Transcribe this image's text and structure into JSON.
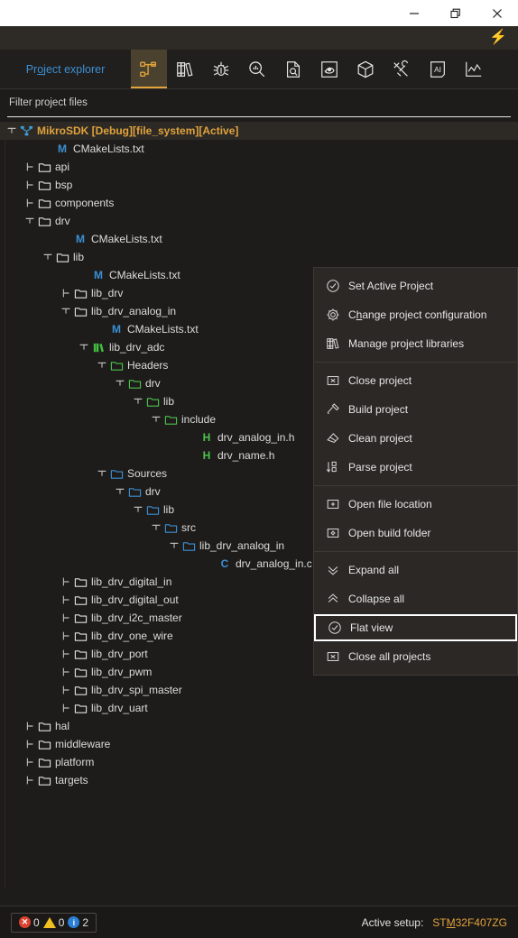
{
  "titlebar": {
    "minimize": "minimize-icon",
    "restore": "restore-icon",
    "close": "close-icon"
  },
  "boltbar": {
    "bolt": "⚡"
  },
  "toolbar": {
    "tab_label_pre": "Pr",
    "tab_label_mnemonic": "o",
    "tab_label_post": "ject explorer",
    "buttons": [
      {
        "name": "project-explorer-icon",
        "title": "Project explorer",
        "active": true
      },
      {
        "name": "library-manager-icon",
        "title": "Library Manager",
        "active": false
      },
      {
        "name": "debugger-icon",
        "title": "Debugger",
        "active": false
      },
      {
        "name": "search-icon",
        "title": "Search",
        "active": false
      },
      {
        "name": "file-preview-icon",
        "title": "File preview",
        "active": false
      },
      {
        "name": "target-icon",
        "title": "Target",
        "active": false
      },
      {
        "name": "package-icon",
        "title": "Package manager",
        "active": false
      },
      {
        "name": "tools-icon",
        "title": "Tools",
        "active": false
      },
      {
        "name": "ai-assistant-icon",
        "title": "AI assistant",
        "active": false
      },
      {
        "name": "chart-icon",
        "title": "Chart",
        "active": false
      }
    ]
  },
  "filter": {
    "placeholder": "Filter project files",
    "value": ""
  },
  "tree": {
    "rows": [
      {
        "depth": 0,
        "twisty": "expanded",
        "icon": "project-icon",
        "label": "MikroSDK [Debug][file_system][Active]",
        "color": "root",
        "root": true
      },
      {
        "depth": 2,
        "twisty": "none",
        "icon": "makefile-icon",
        "label": "CMakeLists.txt",
        "color": "white"
      },
      {
        "depth": 1,
        "twisty": "collapsed",
        "icon": "folder-white",
        "label": "api",
        "color": "white"
      },
      {
        "depth": 1,
        "twisty": "collapsed",
        "icon": "folder-white",
        "label": "bsp",
        "color": "white"
      },
      {
        "depth": 1,
        "twisty": "collapsed",
        "icon": "folder-white",
        "label": "components",
        "color": "white"
      },
      {
        "depth": 1,
        "twisty": "expanded",
        "icon": "folder-white",
        "label": "drv",
        "color": "white"
      },
      {
        "depth": 3,
        "twisty": "none",
        "icon": "makefile-icon",
        "label": "CMakeLists.txt",
        "color": "white"
      },
      {
        "depth": 2,
        "twisty": "expanded",
        "icon": "folder-white",
        "label": "lib",
        "color": "white"
      },
      {
        "depth": 4,
        "twisty": "none",
        "icon": "makefile-icon",
        "label": "CMakeLists.txt",
        "color": "white"
      },
      {
        "depth": 3,
        "twisty": "collapsed",
        "icon": "folder-white",
        "label": "lib_drv",
        "color": "white"
      },
      {
        "depth": 3,
        "twisty": "expanded",
        "icon": "folder-white",
        "label": "lib_drv_analog_in",
        "color": "white"
      },
      {
        "depth": 5,
        "twisty": "none",
        "icon": "makefile-icon",
        "label": "CMakeLists.txt",
        "color": "white"
      },
      {
        "depth": 4,
        "twisty": "expanded",
        "icon": "library-green",
        "label": "lib_drv_adc",
        "color": "white"
      },
      {
        "depth": 5,
        "twisty": "expanded",
        "icon": "folder-green",
        "label": "Headers",
        "color": "white"
      },
      {
        "depth": 6,
        "twisty": "expanded",
        "icon": "folder-green",
        "label": "drv",
        "color": "white"
      },
      {
        "depth": 7,
        "twisty": "expanded",
        "icon": "folder-green",
        "label": "lib",
        "color": "white"
      },
      {
        "depth": 8,
        "twisty": "expanded",
        "icon": "folder-green",
        "label": "include",
        "color": "white"
      },
      {
        "depth": 10,
        "twisty": "none",
        "icon": "header-icon",
        "label": "drv_analog_in.h",
        "color": "white"
      },
      {
        "depth": 10,
        "twisty": "none",
        "icon": "header-icon",
        "label": "drv_name.h",
        "color": "white"
      },
      {
        "depth": 5,
        "twisty": "expanded",
        "icon": "folder-blue",
        "label": "Sources",
        "color": "white"
      },
      {
        "depth": 6,
        "twisty": "expanded",
        "icon": "folder-blue",
        "label": "drv",
        "color": "white"
      },
      {
        "depth": 7,
        "twisty": "expanded",
        "icon": "folder-blue",
        "label": "lib",
        "color": "white"
      },
      {
        "depth": 8,
        "twisty": "expanded",
        "icon": "folder-blue",
        "label": "src",
        "color": "white"
      },
      {
        "depth": 9,
        "twisty": "expanded",
        "icon": "folder-blue",
        "label": "lib_drv_analog_in",
        "color": "white"
      },
      {
        "depth": 11,
        "twisty": "none",
        "icon": "csource-icon",
        "label": "drv_analog_in.c",
        "color": "white"
      },
      {
        "depth": 3,
        "twisty": "collapsed",
        "icon": "folder-white",
        "label": "lib_drv_digital_in",
        "color": "white"
      },
      {
        "depth": 3,
        "twisty": "collapsed",
        "icon": "folder-white",
        "label": "lib_drv_digital_out",
        "color": "white"
      },
      {
        "depth": 3,
        "twisty": "collapsed",
        "icon": "folder-white",
        "label": "lib_drv_i2c_master",
        "color": "white"
      },
      {
        "depth": 3,
        "twisty": "collapsed",
        "icon": "folder-white",
        "label": "lib_drv_one_wire",
        "color": "white"
      },
      {
        "depth": 3,
        "twisty": "collapsed",
        "icon": "folder-white",
        "label": "lib_drv_port",
        "color": "white"
      },
      {
        "depth": 3,
        "twisty": "collapsed",
        "icon": "folder-white",
        "label": "lib_drv_pwm",
        "color": "white"
      },
      {
        "depth": 3,
        "twisty": "collapsed",
        "icon": "folder-white",
        "label": "lib_drv_spi_master",
        "color": "white"
      },
      {
        "depth": 3,
        "twisty": "collapsed",
        "icon": "folder-white",
        "label": "lib_drv_uart",
        "color": "white"
      },
      {
        "depth": 1,
        "twisty": "collapsed",
        "icon": "folder-white",
        "label": "hal",
        "color": "white"
      },
      {
        "depth": 1,
        "twisty": "collapsed",
        "icon": "folder-white",
        "label": "middleware",
        "color": "white"
      },
      {
        "depth": 1,
        "twisty": "collapsed",
        "icon": "folder-white",
        "label": "platform",
        "color": "white"
      },
      {
        "depth": 1,
        "twisty": "collapsed",
        "icon": "folder-white",
        "label": "targets",
        "color": "white"
      }
    ]
  },
  "context_menu": {
    "items": [
      {
        "type": "item",
        "icon": "check-circle-icon",
        "label": "Set Active Project",
        "mnemonic": "",
        "selected": false
      },
      {
        "type": "item",
        "icon": "gear-icon",
        "label": "Change project configuration",
        "mnemonic": "h",
        "selected": false
      },
      {
        "type": "item",
        "icon": "books-icon",
        "label": "Manage project libraries",
        "mnemonic": "",
        "selected": false
      },
      {
        "type": "sep"
      },
      {
        "type": "item",
        "icon": "close-box-icon",
        "label": "Close project",
        "mnemonic": "",
        "selected": false
      },
      {
        "type": "item",
        "icon": "hammer-icon",
        "label": "Build project",
        "mnemonic": "",
        "selected": false
      },
      {
        "type": "item",
        "icon": "eraser-icon",
        "label": "Clean project",
        "mnemonic": "",
        "selected": false
      },
      {
        "type": "item",
        "icon": "parse-icon",
        "label": "Parse project",
        "mnemonic": "",
        "selected": false
      },
      {
        "type": "sep"
      },
      {
        "type": "item",
        "icon": "open-folder-plus-icon",
        "label": "Open file location",
        "mnemonic": "",
        "selected": false
      },
      {
        "type": "item",
        "icon": "open-folder-gear-icon",
        "label": "Open build folder",
        "mnemonic": "",
        "selected": false
      },
      {
        "type": "sep"
      },
      {
        "type": "item",
        "icon": "chevrons-down-icon",
        "label": "Expand all",
        "mnemonic": "",
        "selected": false
      },
      {
        "type": "item",
        "icon": "chevrons-up-icon",
        "label": "Collapse all",
        "mnemonic": "",
        "selected": false
      },
      {
        "type": "item",
        "icon": "check-circle-icon",
        "label": "Flat view",
        "mnemonic": "",
        "selected": true
      },
      {
        "type": "item",
        "icon": "close-box-icon",
        "label": "Close all projects",
        "mnemonic": "",
        "selected": false
      }
    ]
  },
  "statusbar": {
    "errors": "0",
    "warnings": "0",
    "infos": "2",
    "active_setup_label": "Active setup:",
    "active_setup_pre": "ST",
    "active_setup_mnemonic": "M",
    "active_setup_post": "32F407ZG"
  },
  "colors": {
    "accent": "#e0a23c",
    "link": "#3b8fd4",
    "green": "#4cc24c",
    "bg": "#1e1c1a",
    "menu_bg": "#2b2825"
  }
}
